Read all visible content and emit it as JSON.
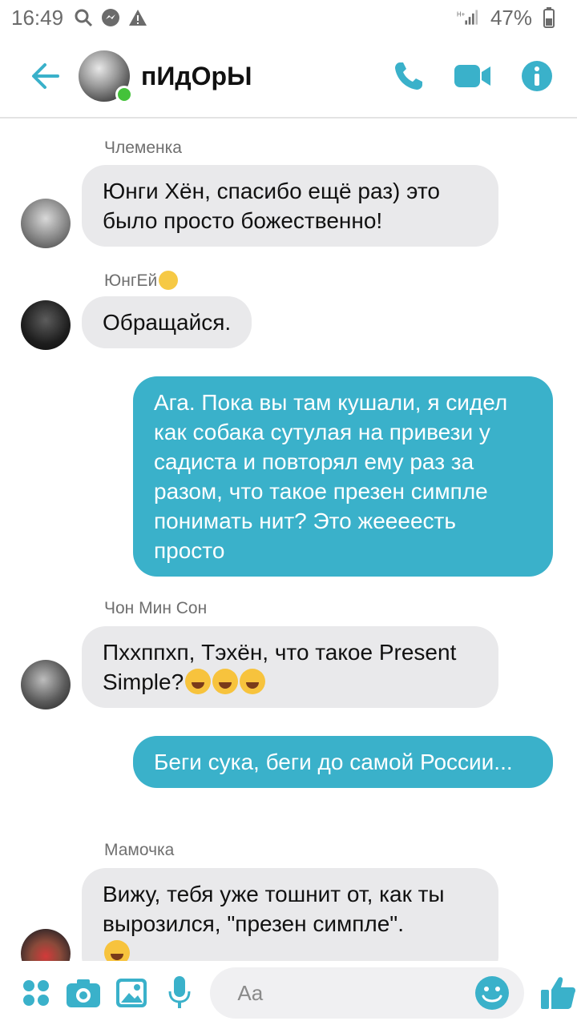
{
  "status_bar": {
    "time": "16:49",
    "battery": "47%"
  },
  "header": {
    "title": "пИдОрЫ"
  },
  "messages": [
    {
      "sender": "Члеменка",
      "text": "Юнги Хён, спасибо ещё раз) это было просто божественно!"
    },
    {
      "sender": "ЮнгЕй",
      "text": "Обращайся."
    },
    {
      "text": "Ага. Пока вы там кушали, я сидел как собака сутулая на привези у садиста и повторял ему раз за разом, что такое презен симпле понимать нит? Это жеееесть просто"
    },
    {
      "sender": "Чон Мин Сон",
      "text": "Пххппхп, Тэхён, что такое Present Simple?"
    },
    {
      "text": "Беги сука, беги до самой России..."
    },
    {
      "sender": "Мамочка",
      "text": "Вижу, тебя уже тошнит от, как ты вырозился, \"презен симпле\"."
    }
  ],
  "composer": {
    "placeholder": "Aa"
  },
  "colors": {
    "accent": "#3ab1ca",
    "incoming_bubble": "#e9e9eb",
    "online": "#44c23a"
  },
  "icons": {
    "status": [
      "search-icon",
      "messenger-icon",
      "warning-icon",
      "signal-icon"
    ],
    "header": [
      "back-arrow-icon",
      "phone-icon",
      "video-camera-icon",
      "info-icon"
    ],
    "composer": [
      "apps-icon",
      "camera-icon",
      "gallery-icon",
      "microphone-icon",
      "emoji-icon",
      "thumbs-up-icon"
    ]
  }
}
